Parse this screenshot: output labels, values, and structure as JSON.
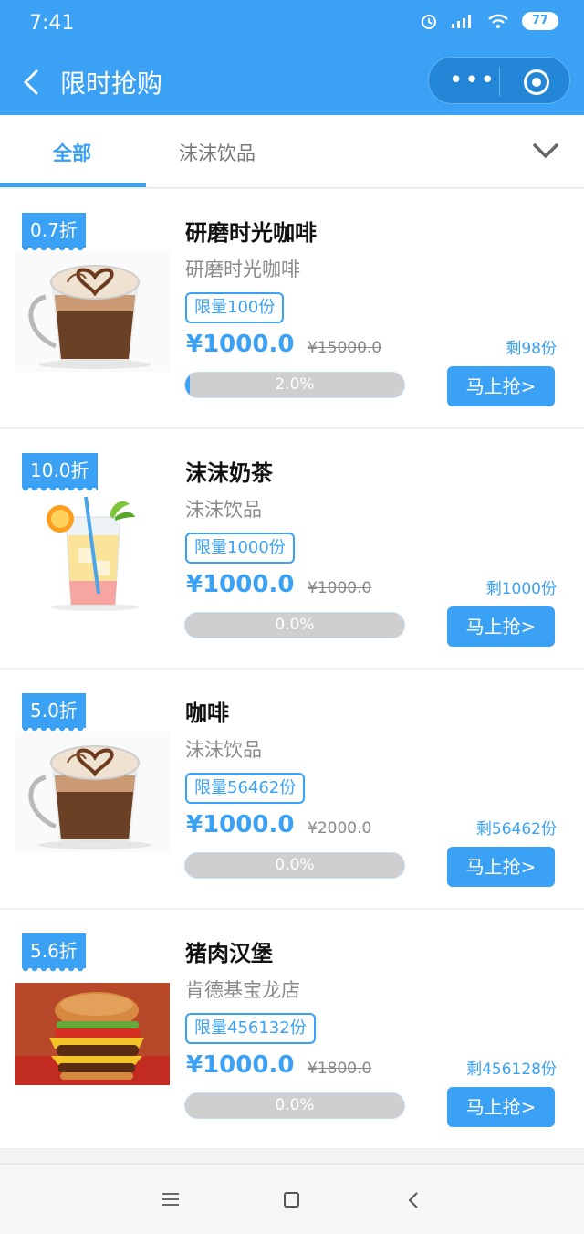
{
  "status": {
    "time": "7:41",
    "battery": "77"
  },
  "nav": {
    "title": "限时抢购",
    "more": "•••"
  },
  "tabs": [
    {
      "label": "全部",
      "active": true
    },
    {
      "label": "沫沫饮品",
      "active": false
    }
  ],
  "colors": {
    "accent": "#3aa1f5"
  },
  "items": [
    {
      "discount": "0.7折",
      "title": "研磨时光咖啡",
      "shop": "研磨时光咖啡",
      "limit": "限量100份",
      "price": "¥1000.0",
      "orig": "¥15000.0",
      "remain": "剩98份",
      "progress_text": "2.0%",
      "progress": 0.02,
      "buy": "马上抢>",
      "image": "coffee"
    },
    {
      "discount": "10.0折",
      "title": "沫沫奶茶",
      "shop": "沫沫饮品",
      "limit": "限量1000份",
      "price": "¥1000.0",
      "orig": "¥1000.0",
      "remain": "剩1000份",
      "progress_text": "0.0%",
      "progress": 0,
      "buy": "马上抢>",
      "image": "juice"
    },
    {
      "discount": "5.0折",
      "title": "咖啡",
      "shop": "沫沫饮品",
      "limit": "限量56462份",
      "price": "¥1000.0",
      "orig": "¥2000.0",
      "remain": "剩56462份",
      "progress_text": "0.0%",
      "progress": 0,
      "buy": "马上抢>",
      "image": "coffee"
    },
    {
      "discount": "5.6折",
      "title": "猪肉汉堡",
      "shop": "肯德基宝龙店",
      "limit": "限量456132份",
      "price": "¥1000.0",
      "orig": "¥1800.0",
      "remain": "剩456128份",
      "progress_text": "0.0%",
      "progress": 0,
      "buy": "马上抢>",
      "image": "burger"
    }
  ]
}
